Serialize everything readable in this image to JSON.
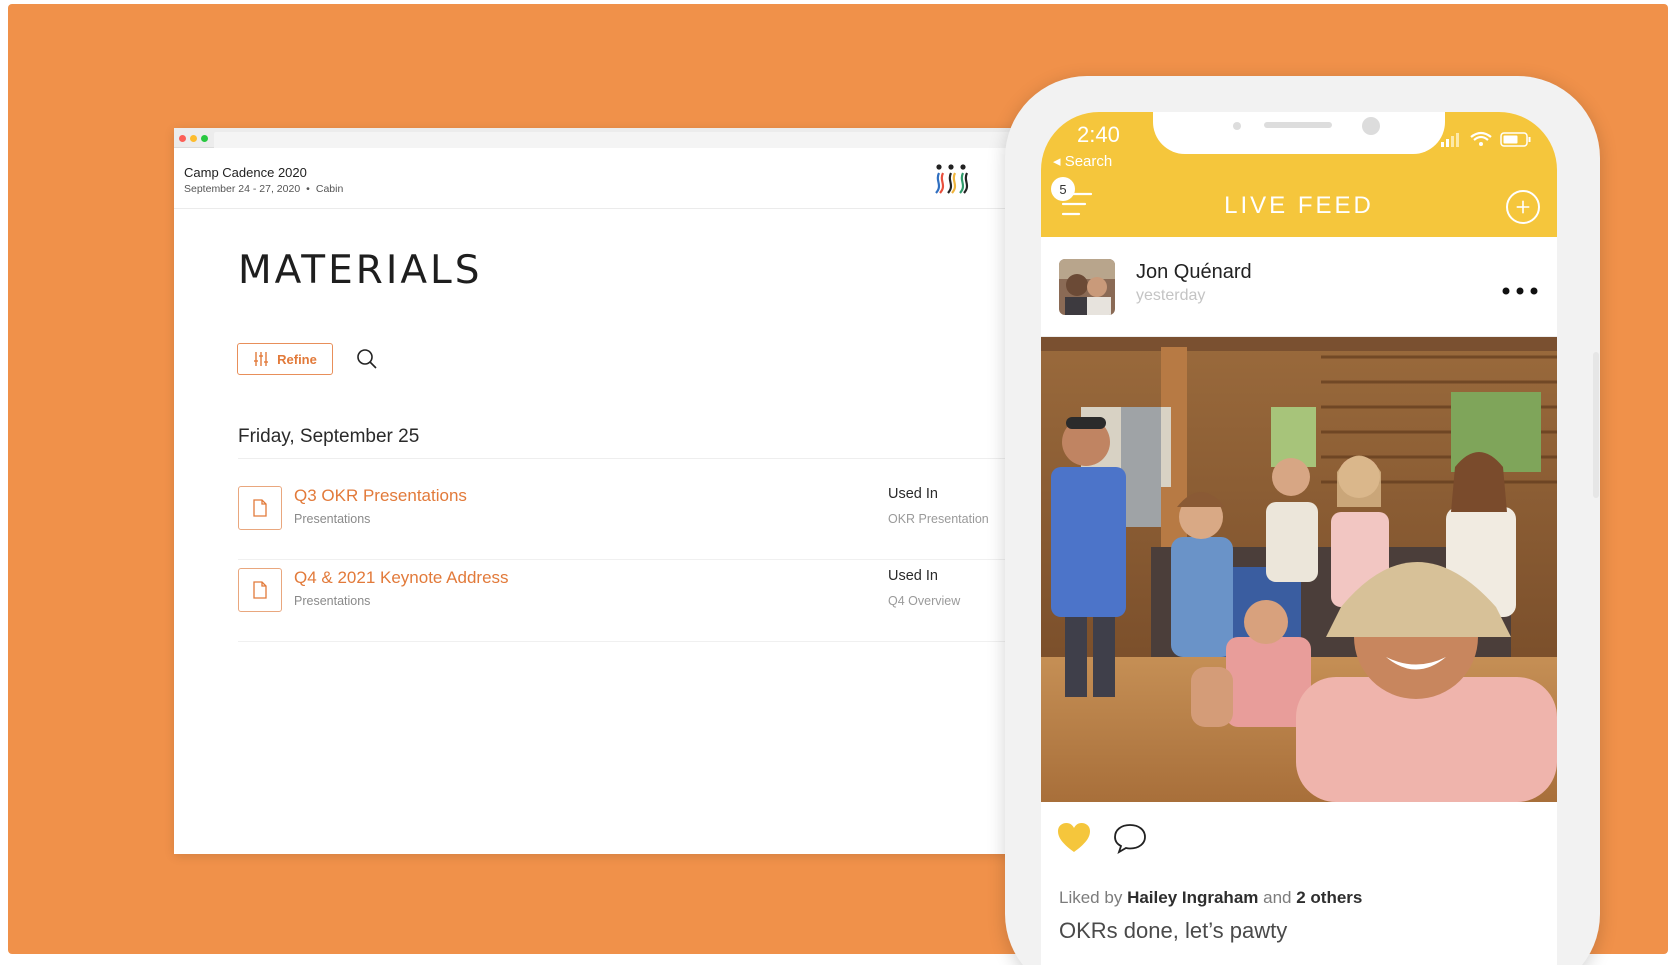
{
  "colors": {
    "background": "#f0914a",
    "accent_orange": "#e27a3a",
    "feed_yellow": "#f5c63c"
  },
  "desktop": {
    "event": {
      "name": "Camp Cadence 2020",
      "dates": "September 24 - 27, 2020",
      "separator": "•",
      "location": "Cabin"
    },
    "logo_icon": "cadence-logo",
    "page_title": "MATERIALS",
    "refine_label": "Refine",
    "refine_icon": "sliders-icon",
    "search_icon": "search-icon",
    "date_heading": "Friday, September 25",
    "materials": [
      {
        "title": "Q3 OKR Presentations",
        "type": "Presentations",
        "used_in_label": "Used In",
        "used_in_value": "OKR Presentation"
      },
      {
        "title": "Q4 & 2021 Keynote Address",
        "type": "Presentations",
        "used_in_label": "Used In",
        "used_in_value": "Q4 Overview"
      }
    ]
  },
  "phone": {
    "status": {
      "time": "2:40",
      "back_label": "◂ Search"
    },
    "header": {
      "badge_count": "5",
      "title": "LIVE FEED",
      "add_icon": "plus-circle-icon",
      "menu_icon": "menu-icon"
    },
    "post": {
      "author": "Jon Quénard",
      "time": "yesterday",
      "more_icon": "more-icon",
      "like_icon": "heart-icon",
      "comment_icon": "comment-icon",
      "liked_prefix": "Liked by",
      "liked_name": "Hailey Ingraham",
      "liked_and": "and",
      "liked_others": "2 others",
      "caption": "OKRs done, let’s pawty"
    }
  }
}
